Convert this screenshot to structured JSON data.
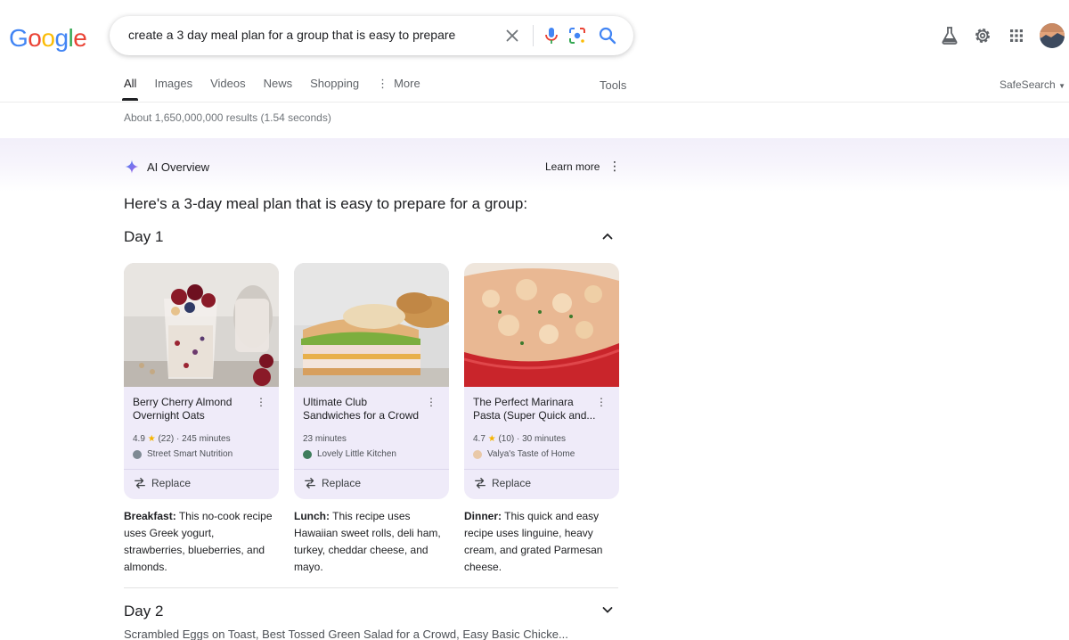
{
  "logo": {
    "letters": [
      "G",
      "o",
      "o",
      "g",
      "l",
      "e"
    ],
    "colors": [
      "#4285F4",
      "#EA4335",
      "#FBBC05",
      "#4285F4",
      "#34A853",
      "#EA4335"
    ]
  },
  "search": {
    "query": "create a 3 day meal plan for a group that is easy to prepare"
  },
  "tabs": [
    {
      "label": "All",
      "active": true
    },
    {
      "label": "Images"
    },
    {
      "label": "Videos"
    },
    {
      "label": "News"
    },
    {
      "label": "Shopping"
    },
    {
      "label": "More"
    }
  ],
  "tools_label": "Tools",
  "safesearch_label": "SafeSearch",
  "result_stats": "About 1,650,000,000 results (1.54 seconds)",
  "ai_overview": {
    "label": "AI Overview",
    "learn_more": "Learn more",
    "heading": "Here's a 3-day meal plan that is easy to prepare for a group:"
  },
  "day1": {
    "title": "Day 1",
    "cards": [
      {
        "title": "Berry Cherry Almond Overnight Oats",
        "rating": "4.9",
        "reviews": "(22)",
        "time": "245 minutes",
        "source": "Street Smart Nutrition",
        "replace": "Replace"
      },
      {
        "title": "Ultimate Club Sandwiches for a Crowd",
        "time": "23 minutes",
        "source": "Lovely Little Kitchen",
        "replace": "Replace"
      },
      {
        "title": "The Perfect Marinara Pasta (Super Quick and...",
        "rating": "4.7",
        "reviews": "(10)",
        "time": "30 minutes",
        "source": "Valya's Taste of Home",
        "replace": "Replace"
      }
    ],
    "descriptions": [
      {
        "label": "Breakfast:",
        "text": " This no-cook recipe uses Greek yogurt, strawberries, blueberries, and almonds."
      },
      {
        "label": "Lunch:",
        "text": " This recipe uses Hawaiian sweet rolls, deli ham, turkey, cheddar cheese, and mayo."
      },
      {
        "label": "Dinner:",
        "text": " This quick and easy recipe uses linguine, heavy cream, and grated Parmesan cheese."
      }
    ]
  },
  "day2": {
    "title": "Day 2",
    "summary": "Scrambled Eggs on Toast, Best Tossed Green Salad for a Crowd, Easy Basic Chicke..."
  },
  "icons": {
    "clear": "close-icon",
    "mic": "mic-icon",
    "lens": "lens-icon",
    "search": "search-icon",
    "labs": "flask-icon",
    "settings": "gear-icon",
    "apps": "apps-grid-icon",
    "ai": "sparkle-icon",
    "more": "more-vert-icon",
    "expand": "chevron-icon",
    "replace": "swap-icon"
  }
}
